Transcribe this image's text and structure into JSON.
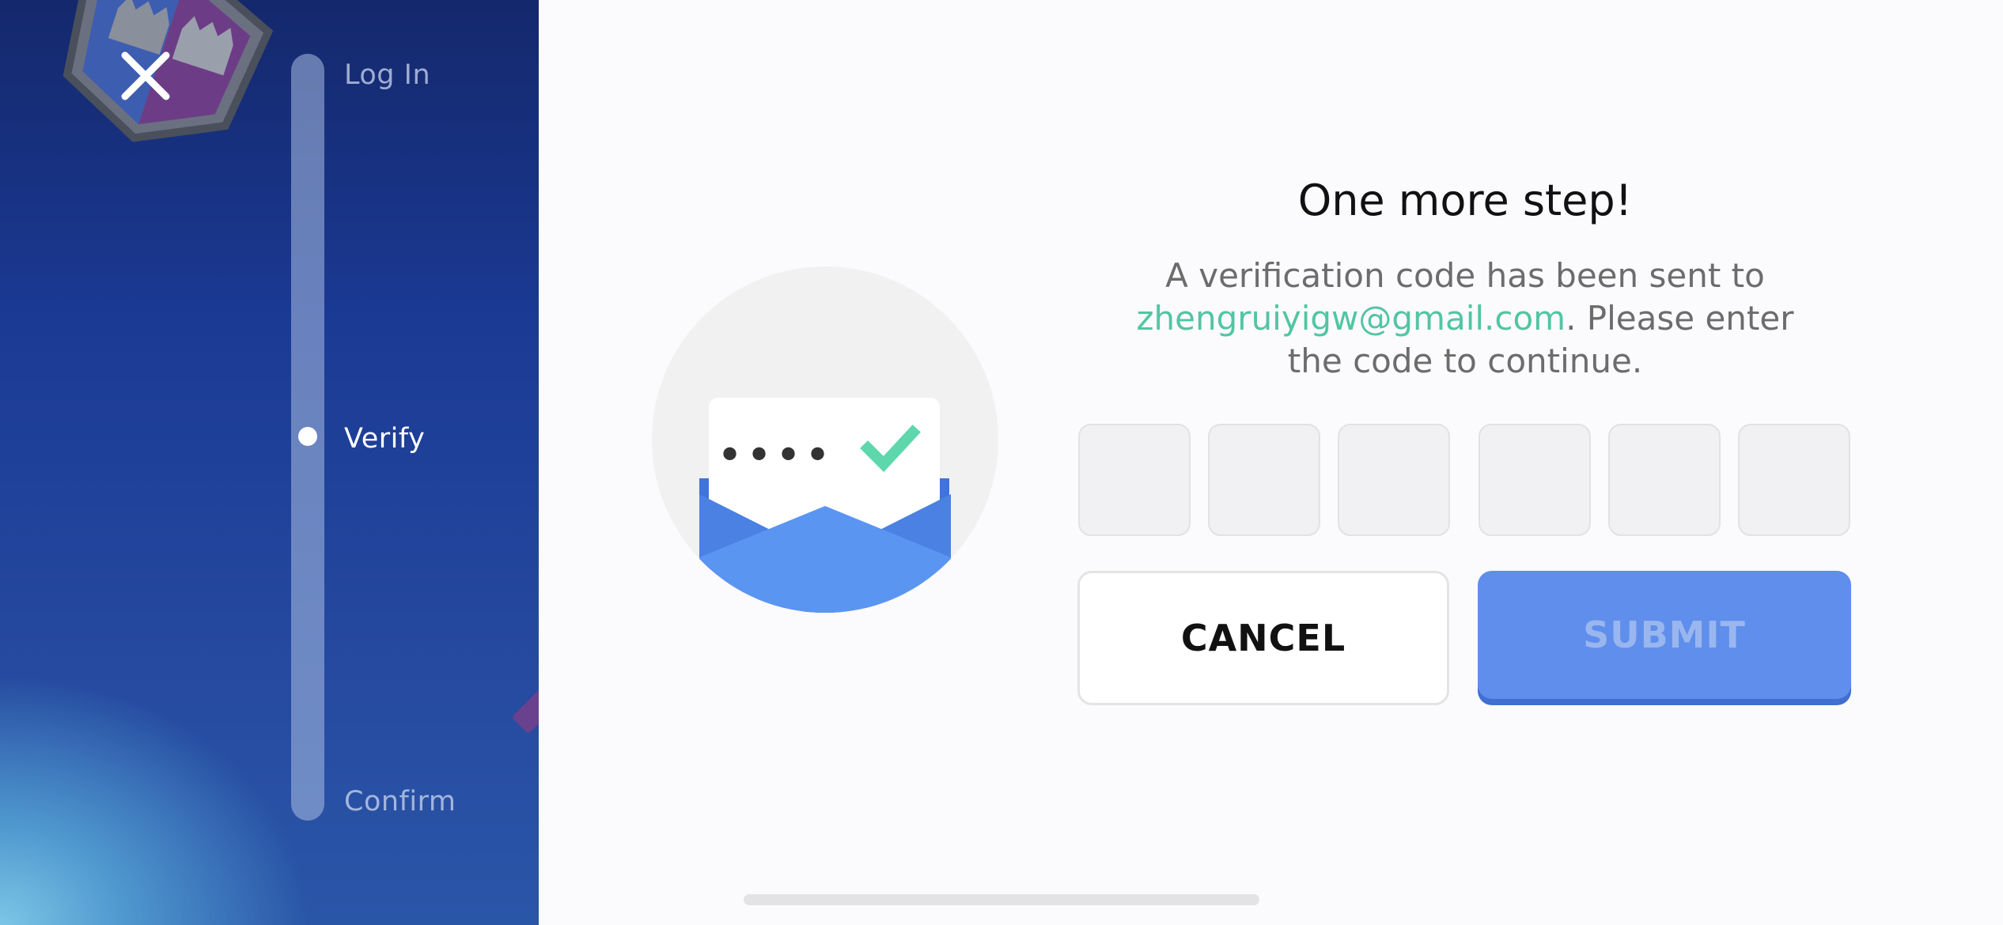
{
  "sidebar": {
    "steps": [
      {
        "label": "Log In",
        "state": "inactive"
      },
      {
        "label": "Verify",
        "state": "current"
      },
      {
        "label": "Confirm",
        "state": "inactive"
      }
    ],
    "close_icon": "close-icon"
  },
  "main": {
    "title": "One more step!",
    "description_prefix": "A verification code has been sent to",
    "email": "zhengruiyigw@gmail.com",
    "description_suffix": ". Please enter the code to continue.",
    "code_boxes": [
      "",
      "",
      "",
      "",
      "",
      ""
    ],
    "cancel_label": "CANCEL",
    "submit_label": "SUBMIT",
    "illustration_code_mask": "••••"
  },
  "colors": {
    "accent_green": "#52c5a2",
    "submit_blue": "#5f8eec",
    "panel_blue": "#1b3a94"
  }
}
